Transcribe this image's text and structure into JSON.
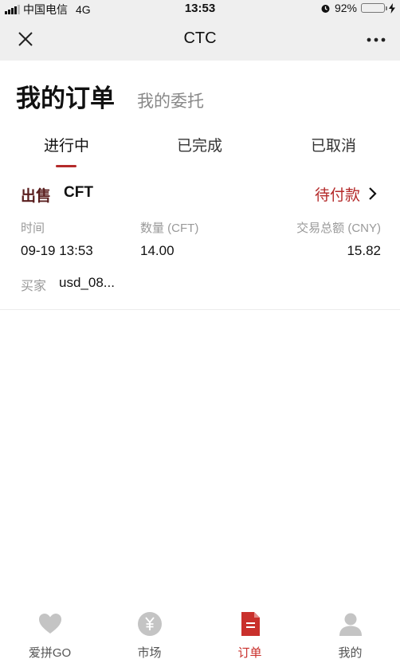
{
  "status_bar": {
    "carrier": "中国电信",
    "network": "4G",
    "time": "13:53",
    "battery": "92%",
    "battery_level": 0.92
  },
  "nav": {
    "title": "CTC",
    "close_icon": "close-icon",
    "more_icon": "more-icon"
  },
  "heading": {
    "active": "我的订单",
    "inactive": "我的委托"
  },
  "tabs": [
    {
      "label": "进行中",
      "selected": true
    },
    {
      "label": "已完成",
      "selected": false
    },
    {
      "label": "已取消",
      "selected": false
    }
  ],
  "order": {
    "type": "出售",
    "coin": "CFT",
    "status": "待付款",
    "time_label": "时间",
    "time": "09-19 13:53",
    "qty_label": "数量 (CFT)",
    "qty": "14.00",
    "total_label": "交易总额 (CNY)",
    "total": "15.82",
    "buyer_label": "买家",
    "buyer": "usd_08..."
  },
  "tabbar": [
    {
      "label": "爱拼GO",
      "icon": "heart-icon"
    },
    {
      "label": "市场",
      "icon": "yuan-icon"
    },
    {
      "label": "订单",
      "icon": "document-icon",
      "selected": true
    },
    {
      "label": "我的",
      "icon": "user-icon"
    }
  ],
  "colors": {
    "accent": "#b42a2a",
    "nav_bg": "#efefef",
    "tab_active": "#c9302c"
  }
}
